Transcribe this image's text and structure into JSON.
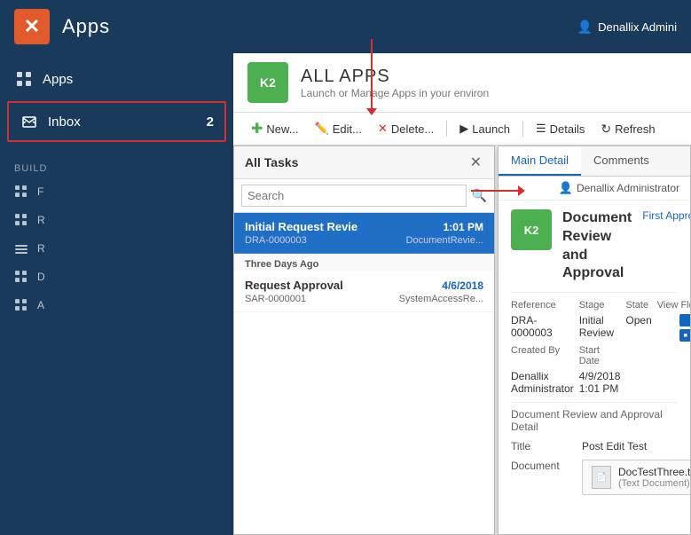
{
  "header": {
    "logo_text": "✕",
    "title": "Apps",
    "user": "Denallix Admini"
  },
  "sidebar": {
    "items": [
      {
        "id": "apps",
        "label": "Apps",
        "icon": "grid"
      },
      {
        "id": "inbox",
        "label": "Inbox",
        "badge": "2",
        "icon": "inbox"
      }
    ],
    "build_section": "BUILD",
    "build_items": [
      {
        "id": "b1",
        "icon": "grid"
      },
      {
        "id": "b2",
        "icon": "grid"
      },
      {
        "id": "b3",
        "icon": "grid"
      },
      {
        "id": "b4",
        "icon": "grid"
      },
      {
        "id": "b5",
        "icon": "grid"
      }
    ]
  },
  "all_apps": {
    "title": "ALL APPS",
    "subtitle": "Launch or Manage Apps in your environ"
  },
  "toolbar": {
    "new_label": "New...",
    "edit_label": "Edit...",
    "delete_label": "Delete...",
    "launch_label": "Launch",
    "details_label": "Details",
    "refresh_label": "Refresh"
  },
  "tasks_panel": {
    "title": "All Tasks",
    "search_placeholder": "Search",
    "items": [
      {
        "id": "t1",
        "name": "Initial Request Revie",
        "time": "1:01 PM",
        "ref": "DRA-0000003",
        "sub": "DocumentRevie...",
        "selected": true
      }
    ],
    "group_label": "Three Days Ago",
    "past_items": [
      {
        "id": "t2",
        "name": "Request Approval",
        "time": "4/6/2018",
        "ref": "SAR-0000001",
        "sub": "SystemAccessRe...",
        "selected": false
      }
    ]
  },
  "detail_panel": {
    "tabs": [
      {
        "id": "main",
        "label": "Main Detail",
        "active": true
      },
      {
        "id": "comments",
        "label": "Comments",
        "active": false
      }
    ],
    "user": "Denallix Administrator",
    "doc_icon_text": "K2",
    "doc_title": "Document Review and Approval",
    "doc_stage": "First Approval",
    "fields": {
      "reference_label": "Reference",
      "reference_value": "DRA-0000003",
      "stage_label": "Stage",
      "stage_value": "Initial Review",
      "state_label": "State",
      "state_value": "Open",
      "view_flow_label": "View Flow",
      "created_by_label": "Created By",
      "created_by_value": "Denallix Administrator",
      "start_date_label": "Start Date",
      "start_date_value": "4/9/2018 1:01 PM"
    },
    "section_title": "Document Review and Approval Detail",
    "title_label": "Title",
    "title_value": "Post Edit Test",
    "document_label": "Document",
    "file_name": "DocTestThree.txt",
    "file_type": "(Text Document)"
  }
}
